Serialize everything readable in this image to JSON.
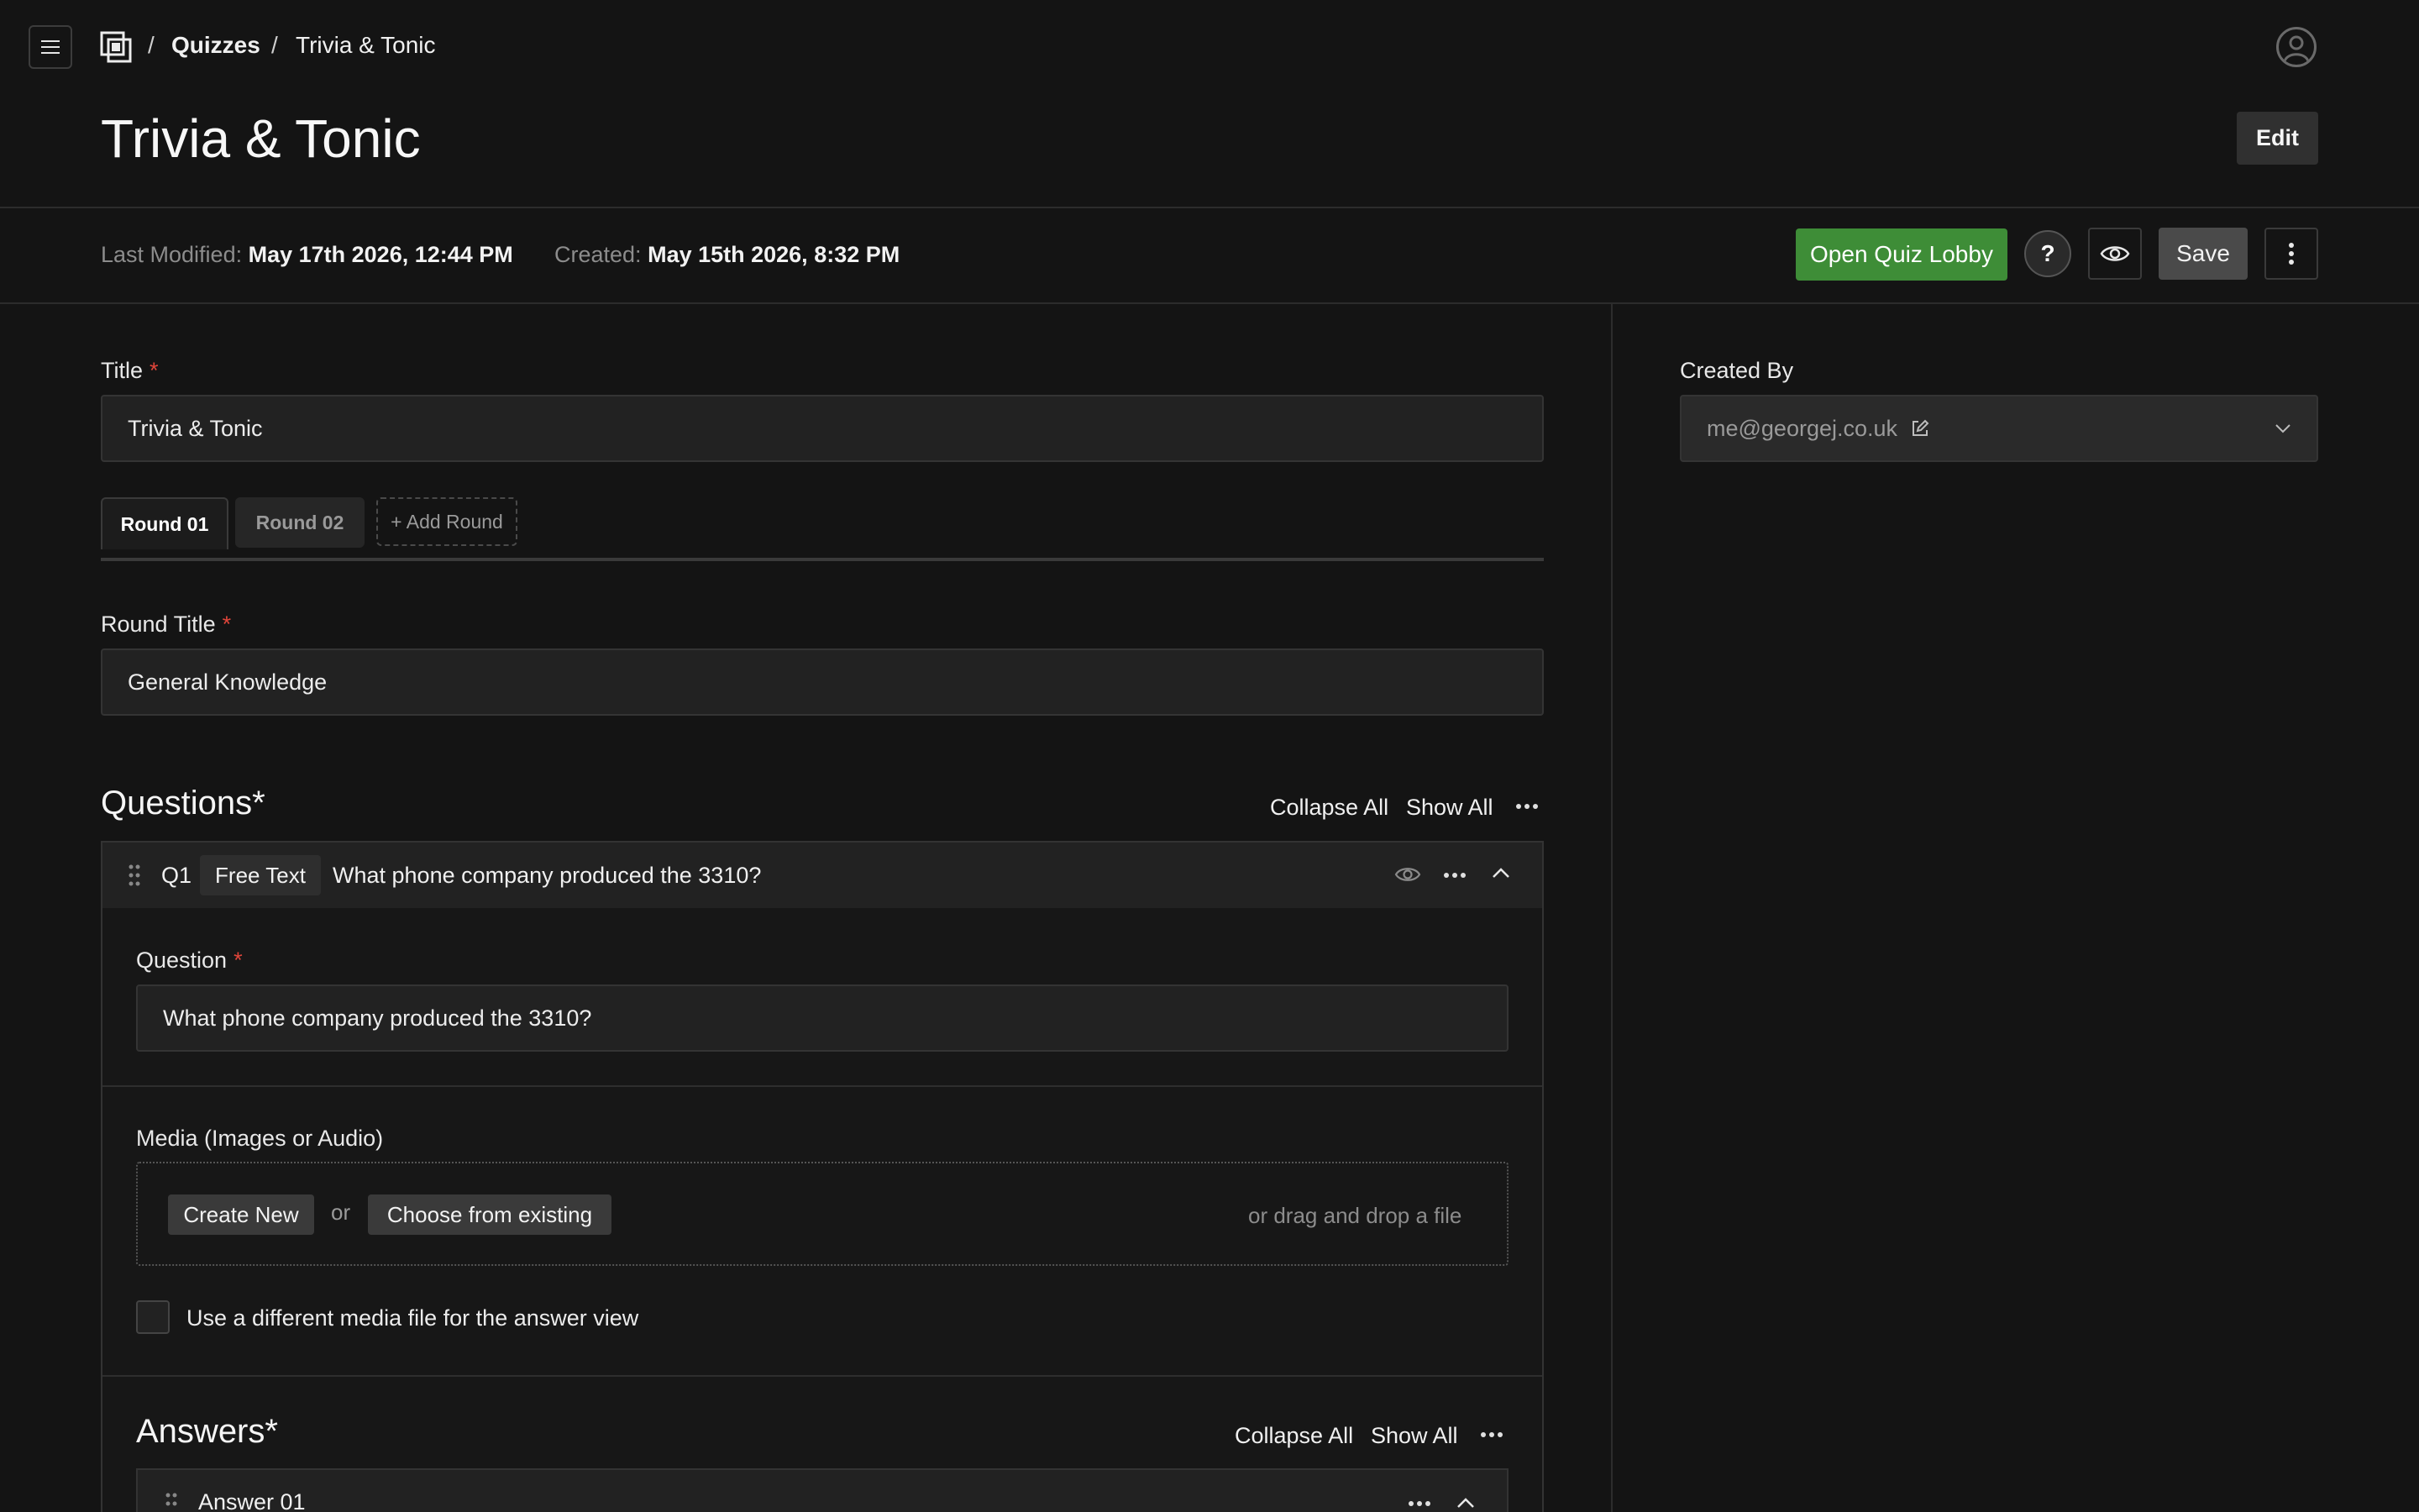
{
  "breadcrumb": {
    "items": [
      "Quizzes",
      "Trivia & Tonic"
    ],
    "separator": "/"
  },
  "page": {
    "title": "Trivia & Tonic",
    "edit_label": "Edit"
  },
  "meta": {
    "last_modified_label": "Last Modified:",
    "last_modified_value": "May 17th 2026, 12:44 PM",
    "created_label": "Created:",
    "created_value": "May 15th 2026, 8:32 PM"
  },
  "actions": {
    "open_lobby": "Open Quiz Lobby",
    "help": "?",
    "save": "Save"
  },
  "form": {
    "title_label": "Title",
    "title_value": "Trivia & Tonic",
    "required_mark": "*",
    "tabs": [
      {
        "label": "Round 01",
        "active": true
      },
      {
        "label": "Round 02",
        "active": false
      }
    ],
    "add_round": "+ Add Round",
    "round_title_label": "Round Title",
    "round_title_value": "General Knowledge"
  },
  "questions": {
    "heading": "Questions*",
    "collapse_all": "Collapse All",
    "show_all": "Show All",
    "items": [
      {
        "number": "Q1",
        "type": "Free Text",
        "summary": "What phone company produced the 3310?",
        "question_label": "Question",
        "question_value": "What phone company produced the 3310?",
        "media_label": "Media (Images or Audio)",
        "create_new": "Create New",
        "or": "or",
        "choose_existing": "Choose from existing",
        "drag_drop": "or drag and drop a file",
        "diff_media_label": "Use a different media file for the answer view"
      }
    ]
  },
  "answers": {
    "heading": "Answers*",
    "collapse_all": "Collapse All",
    "show_all": "Show All",
    "items": [
      {
        "label": "Answer 01"
      }
    ]
  },
  "sidebar": {
    "created_by_label": "Created By",
    "created_by_value": "me@georgej.co.uk"
  },
  "colors": {
    "background": "#141414",
    "accent_green": "#3e8d37",
    "required_red": "#e0453a"
  }
}
